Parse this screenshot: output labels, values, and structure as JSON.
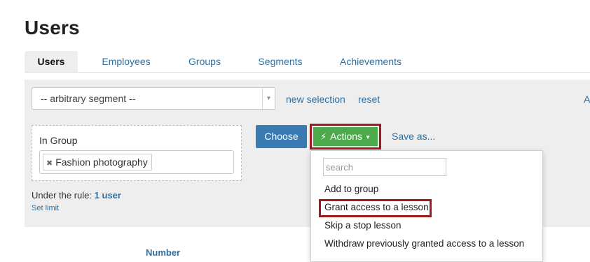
{
  "page": {
    "title": "Users"
  },
  "tabs": [
    {
      "label": "Users",
      "active": true
    },
    {
      "label": "Employees",
      "active": false
    },
    {
      "label": "Groups",
      "active": false
    },
    {
      "label": "Segments",
      "active": false
    },
    {
      "label": "Achievements",
      "active": false
    }
  ],
  "filter": {
    "segment_value": "-- arbitrary segment --",
    "new_selection_label": "new selection",
    "reset_label": "reset",
    "cut_link_label": "A",
    "group": {
      "label": "In Group",
      "tags": [
        "Fashion photography"
      ]
    },
    "rule": {
      "prefix": "Under the rule:",
      "count": "1 user"
    },
    "set_limit_label": "Set limit",
    "choose_label": "Choose",
    "actions_label": "Actions",
    "save_as_label": "Save as..."
  },
  "actions_menu": {
    "search_placeholder": "search",
    "items": [
      "Add to group",
      "Grant access to a lesson",
      "Skip a stop lesson",
      "Withdraw previously granted access to a lesson"
    ],
    "highlighted_index": 1
  },
  "table": {
    "partial_header": "Number"
  },
  "colors": {
    "link": "#2d6fa0",
    "primary_button": "#3b7bb3",
    "success_button": "#4caa4c",
    "highlight_outline": "#9b1c1c",
    "panel_background": "#eeeeee"
  }
}
